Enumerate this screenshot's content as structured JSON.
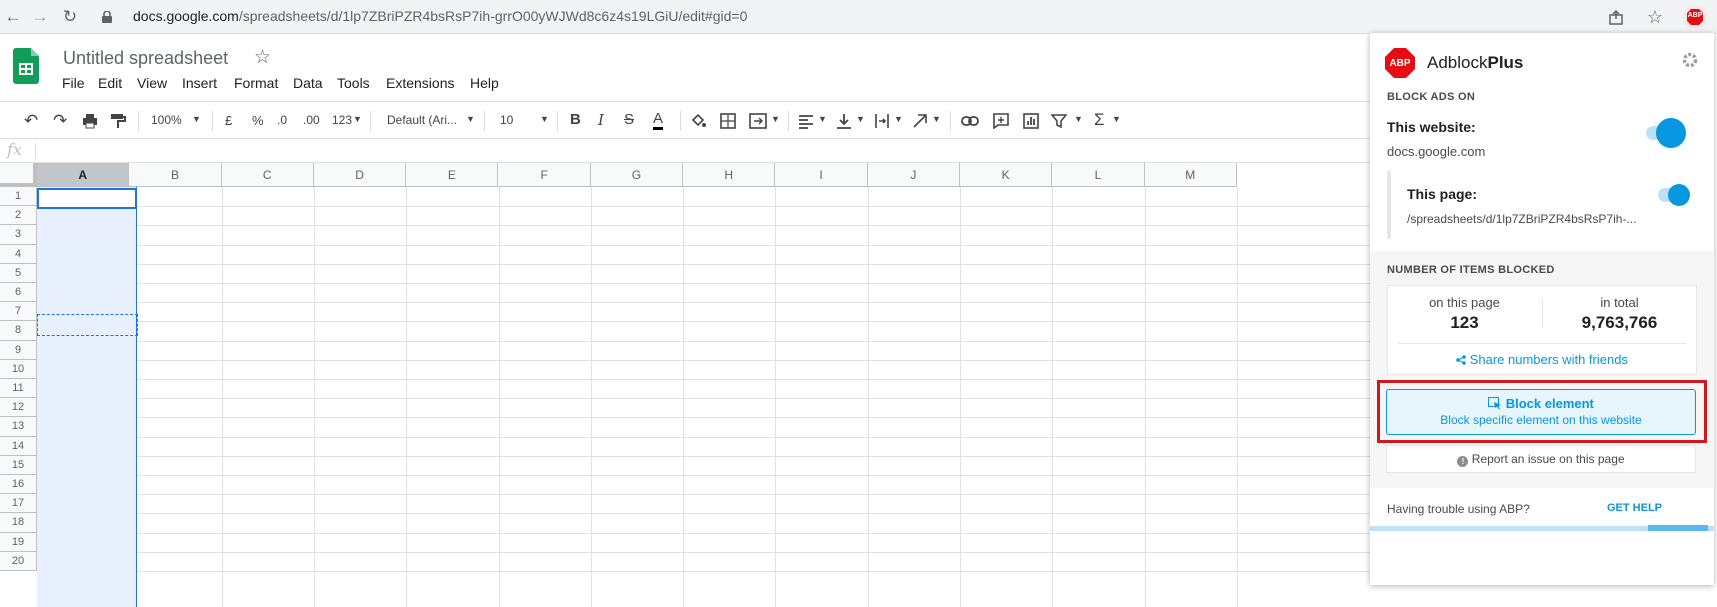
{
  "browser": {
    "url_host": "docs.google.com",
    "url_path": "/spreadsheets/d/1lp7ZBriPZR4bsRsP7ih-grrO00yWJWd8c6z4s19LGiU/edit#gid=0",
    "ext_badge": "ABP"
  },
  "sheets": {
    "title": "Untitled spreadsheet",
    "menu": [
      "File",
      "Edit",
      "View",
      "Insert",
      "Format",
      "Data",
      "Tools",
      "Extensions",
      "Help"
    ],
    "toolbar": {
      "zoom": "100%",
      "currency": "£",
      "percent": "%",
      "dec_less": ".0",
      "dec_more": ".00",
      "num_format": "123",
      "font": "Default (Ari...",
      "font_size": "10"
    },
    "fx": "fx",
    "columns": [
      "A",
      "B",
      "C",
      "D",
      "E",
      "F",
      "G",
      "H",
      "I",
      "J",
      "K",
      "L",
      "M"
    ],
    "rows": [
      "1",
      "2",
      "3",
      "4",
      "5",
      "6",
      "7",
      "8",
      "9",
      "10",
      "11",
      "12",
      "13",
      "14",
      "15",
      "16",
      "17",
      "18",
      "19",
      "20"
    ]
  },
  "abp": {
    "badge": "ABP",
    "brand_regular": "Adblock",
    "brand_bold": "Plus",
    "block_ads_on": "BLOCK ADS ON",
    "this_website_label": "This website:",
    "website_domain": "docs.google.com",
    "this_page_label": "This page:",
    "page_path": "/spreadsheets/d/1lp7ZBriPZR4bsRsP7ih-...",
    "items_blocked_head": "NUMBER OF ITEMS BLOCKED",
    "on_this_page_label": "on this page",
    "on_this_page_value": "123",
    "in_total_label": "in total",
    "in_total_value": "9,763,766",
    "share_label": "Share numbers with friends",
    "block_element_title": "Block element",
    "block_element_sub": "Block specific element on this website",
    "report_issue": "Report an issue on this page",
    "trouble_text": "Having trouble using ABP?",
    "get_help": "GET HELP",
    "colors": {
      "accent": "#0797e1",
      "logo_red": "#e40d14",
      "highlight_border": "#d0181f"
    }
  }
}
